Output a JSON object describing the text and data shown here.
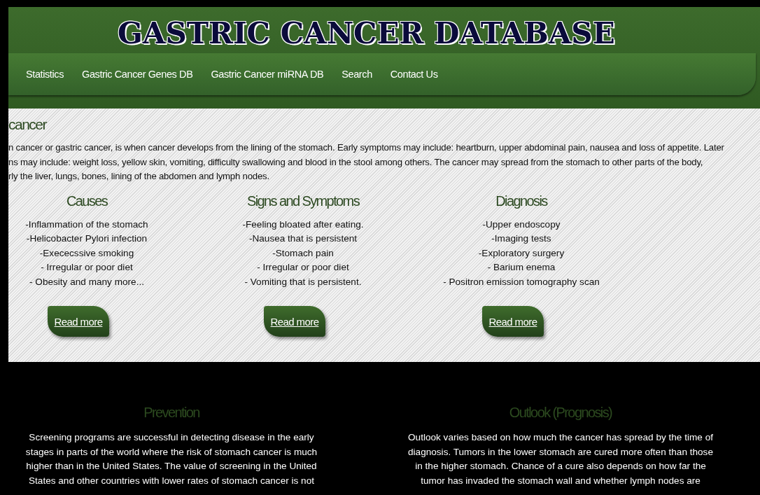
{
  "header": {
    "title": "GASTRIC CANCER DATABASE"
  },
  "nav": {
    "items": [
      {
        "label": "Statistics"
      },
      {
        "label": "Gastric Cancer Genes DB"
      },
      {
        "label": "Gastric Cancer miRNA DB"
      },
      {
        "label": "Search"
      },
      {
        "label": "Contact Us"
      }
    ]
  },
  "intro": {
    "heading": "cancer",
    "lines": [
      "n cancer or gastric cancer, is when cancer develops from the lining of the stomach. Early symptoms may include: heartburn, upper abdominal pain, nausea and loss of appetite. Later",
      "ns may include: weight loss, yellow skin, vomiting, difficulty swallowing and blood in the stool among others. The cancer may spread from the stomach to other parts of the body,",
      "rly the liver, lungs, bones, lining of the abdomen and lymph nodes."
    ]
  },
  "columns": [
    {
      "heading": "Causes",
      "items": [
        "-Inflammation of the stomach",
        "-Helicobacter Pylori infection",
        "-Exececssive smoking",
        "- Irregular or poor diet",
        "- Obesity and many more..."
      ],
      "button": "Read more"
    },
    {
      "heading": "Signs and Symptoms",
      "items": [
        "-Feeling bloated after eating.",
        "-Nausea that is persistent",
        "-Stomach pain",
        "- Irregular or poor diet",
        "- Vomiting that is persistent."
      ],
      "button": "Read more"
    },
    {
      "heading": "Diagnosis",
      "items": [
        "-Upper endoscopy",
        "-Imaging tests",
        "-Exploratory surgery",
        "- Barium enema",
        "- Positron emission tomography scan"
      ],
      "button": "Read more"
    }
  ],
  "bottom": [
    {
      "heading": "Prevention",
      "lines": [
        "Screening programs are successful in detecting disease in the early",
        "stages in parts of the world where the risk of stomach cancer is much",
        "higher than in the United States. The value of screening in the United",
        "States and other countries with lower rates of stomach cancer is not"
      ]
    },
    {
      "heading": "Outlook (Prognosis)",
      "lines": [
        "Outlook varies based on how much the cancer has spread by the time of",
        "diagnosis. Tumors in the lower stomach are cured more often than those",
        "in the higher stomach. Chance of a cure also depends on how far the",
        "tumor has invaded the stomach wall and whether lymph nodes are"
      ]
    }
  ]
}
